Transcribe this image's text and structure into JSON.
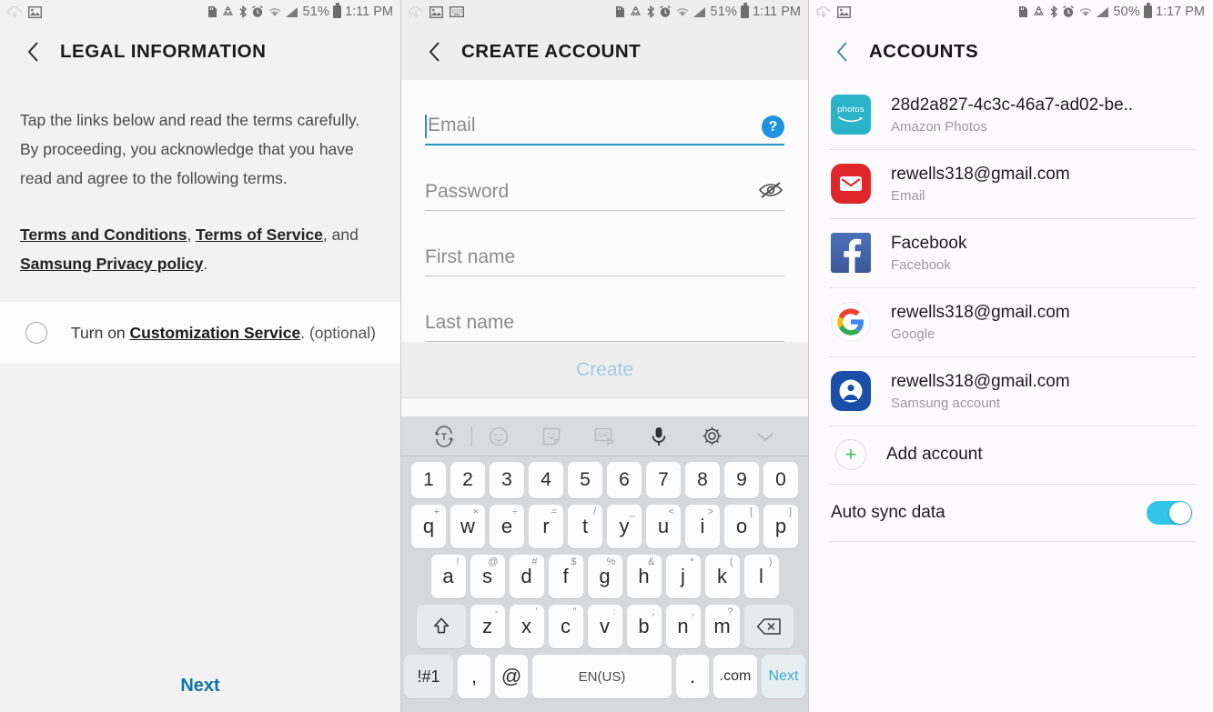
{
  "panel1": {
    "statusbar": {
      "left_icons": [
        "cloud-sync-icon",
        "image-icon"
      ],
      "right_icons": [
        "sd-card-icon",
        "data-saver-icon",
        "bluetooth-icon",
        "alarm-icon",
        "wifi-icon",
        "signal-icon"
      ],
      "battery": "51%",
      "time": "1:11 PM"
    },
    "title": "LEGAL INFORMATION",
    "paragraph": "Tap the links below and read the terms carefully. By proceeding, you acknowledge that you have read and agree to the following terms.",
    "links": {
      "link1": "Terms and Conditions",
      "sep1": ", ",
      "link2": "Terms of Service",
      "sep2": ", and ",
      "link3": "Samsung Privacy policy",
      "end": "."
    },
    "option": {
      "prefix": "Turn on ",
      "link": "Customization Service",
      "suffix": ". (optional)",
      "checked": false
    },
    "next_label": "Next",
    "next_color": "#1173ab"
  },
  "panel2": {
    "statusbar": {
      "left_icons": [
        "cloud-sync-icon",
        "image-icon",
        "keyboard-icon"
      ],
      "battery": "51%",
      "time": "1:11 PM"
    },
    "title": "CREATE ACCOUNT",
    "fields": [
      {
        "placeholder": "Email",
        "value": "",
        "focused": true,
        "trailing": "help-icon"
      },
      {
        "placeholder": "Password",
        "value": "",
        "focused": false,
        "trailing": "eye-off-icon"
      },
      {
        "placeholder": "First name",
        "value": "",
        "focused": false,
        "trailing": ""
      },
      {
        "placeholder": "Last name",
        "value": "",
        "focused": false,
        "trailing": ""
      }
    ],
    "create_label": "Create",
    "keyboard": {
      "toolbar": [
        "text-rotate-icon",
        "emoji-icon",
        "sticker-icon",
        "gif-icon",
        "microphone-icon",
        "settings-gear-icon",
        "chevron-down-icon"
      ],
      "row_numbers": [
        "1",
        "2",
        "3",
        "4",
        "5",
        "6",
        "7",
        "8",
        "9",
        "0"
      ],
      "row_top": [
        {
          "k": "q",
          "s": "+"
        },
        {
          "k": "w",
          "s": "×"
        },
        {
          "k": "e",
          "s": "÷"
        },
        {
          "k": "r",
          "s": "="
        },
        {
          "k": "t",
          "s": "/"
        },
        {
          "k": "y",
          "s": "_"
        },
        {
          "k": "u",
          "s": "<"
        },
        {
          "k": "i",
          "s": ">"
        },
        {
          "k": "o",
          "s": "["
        },
        {
          "k": "p",
          "s": "]"
        }
      ],
      "row_home": [
        {
          "k": "a",
          "s": "!"
        },
        {
          "k": "s",
          "s": "@"
        },
        {
          "k": "d",
          "s": "#"
        },
        {
          "k": "f",
          "s": "$"
        },
        {
          "k": "g",
          "s": "%"
        },
        {
          "k": "h",
          "s": "&"
        },
        {
          "k": "j",
          "s": "*"
        },
        {
          "k": "k",
          "s": "("
        },
        {
          "k": "l",
          "s": ")"
        }
      ],
      "row_bottom": [
        {
          "k": "z",
          "s": "-"
        },
        {
          "k": "x",
          "s": "'"
        },
        {
          "k": "c",
          "s": "\""
        },
        {
          "k": "v",
          "s": ":"
        },
        {
          "k": "b",
          "s": ";"
        },
        {
          "k": "n",
          "s": ","
        },
        {
          "k": "m",
          "s": "?"
        }
      ],
      "shift": "shift-icon",
      "backspace": "backspace-icon",
      "symbols_label": "!#1",
      "comma_label": ",",
      "at_label": "@",
      "space_label": "EN(US)",
      "period_label": ".",
      "dotcom_label": ".com",
      "enter_label": "Next"
    }
  },
  "panel3": {
    "statusbar": {
      "left_icons": [
        "cloud-sync-icon",
        "image-icon"
      ],
      "battery": "50%",
      "time": "1:17 PM"
    },
    "title": "ACCOUNTS",
    "accounts": [
      {
        "name": "28d2a827-4c3c-46a7-ad02-be..",
        "type": "Amazon Photos",
        "icon": "amazon-photos-icon"
      },
      {
        "name": "rewells318@gmail.com",
        "type": "Email",
        "icon": "email-icon"
      },
      {
        "name": "Facebook",
        "type": "Facebook",
        "icon": "facebook-icon"
      },
      {
        "name": "rewells318@gmail.com",
        "type": "Google",
        "icon": "google-icon"
      },
      {
        "name": "rewells318@gmail.com",
        "type": "Samsung account",
        "icon": "samsung-account-icon"
      }
    ],
    "add_account_label": "Add account",
    "auto_sync_label": "Auto sync data",
    "auto_sync_on": true,
    "accent_color": "#31c6e8"
  }
}
